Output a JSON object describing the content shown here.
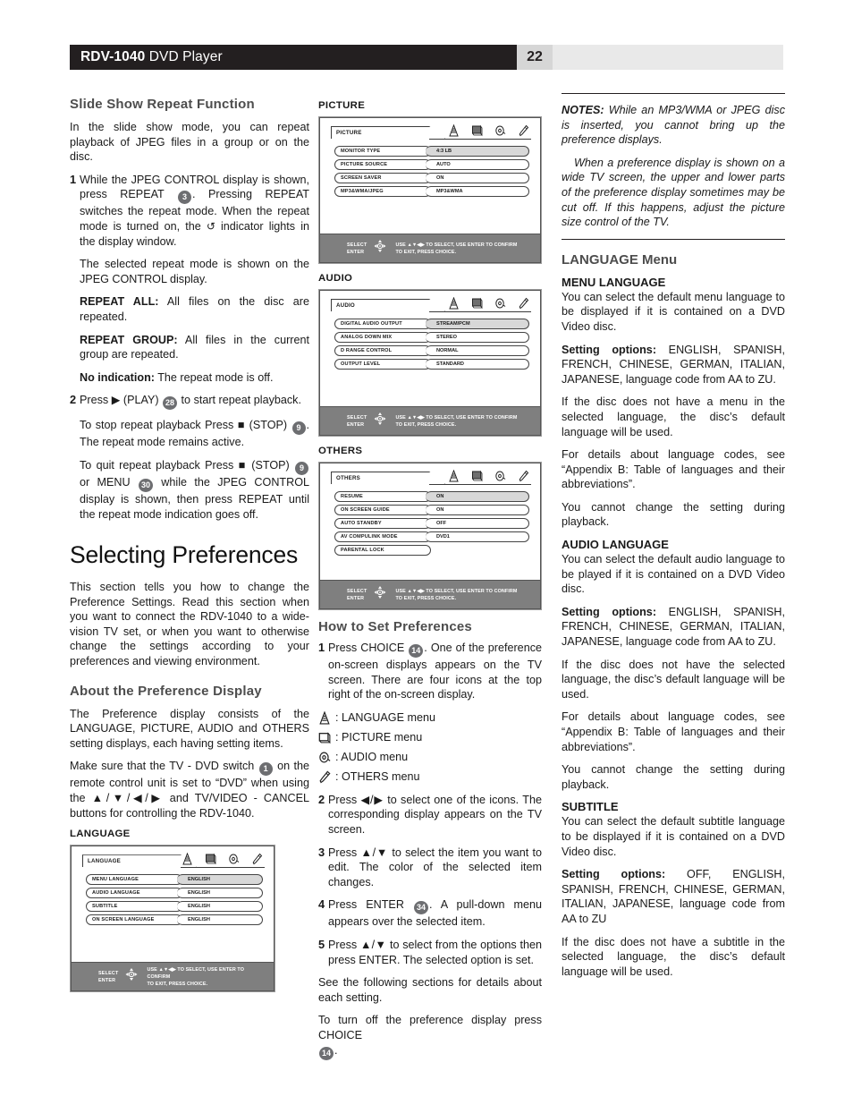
{
  "header": {
    "model": "RDV-1040",
    "product": " DVD Player",
    "page_number": "22"
  },
  "left_column": {
    "heading": "Slide Show Repeat Function",
    "intro": "In the slide show mode, you can repeat playback of JPEG files in a group or on the disc.",
    "step1_pre": "While the JPEG CONTROL display is shown, press REPEAT ",
    "step1_key": "3",
    "step1_mid": ". Pressing REPEAT switches the repeat mode. When the repeat mode is turned on, the ",
    "step1_post": " indicator lights in the display window.",
    "step1_note": "The selected repeat mode is shown on the JPEG CONTROL display.",
    "repeat_all_label": "REPEAT ALL:",
    "repeat_all_text": " All files on the disc are repeated.",
    "repeat_group_label": "REPEAT GROUP:",
    "repeat_group_text": " All files in the current group are repeated.",
    "no_indication_label": "No indication:",
    "no_indication_text": " The repeat mode is off.",
    "step2_pre": "Press ",
    "step2_play": "(PLAY)",
    "step2_key": "28",
    "step2_post": " to start repeat playback.",
    "stop_pre": "To stop repeat playback Press ",
    "stop_label": "(STOP)",
    "stop_key": "9",
    "stop_post": ". The repeat mode remains active.",
    "quit_pre": "To quit repeat playback Press ",
    "quit_stop": "(STOP)",
    "quit_key1": "9",
    "quit_mid": " or MENU ",
    "quit_key2": "30",
    "quit_post": " while the JPEG CONTROL display is shown, then press REPEAT until the repeat mode indication goes off.",
    "title": "Selecting Preferences",
    "intro2": "This section tells you how to change the Preference Settings. Read this section when you want to connect the RDV-1040 to a wide-vision TV set, or when you want to otherwise change the settings according to your preferences and viewing environment.",
    "about_heading": "About the Preference Display",
    "about_p1": "The Preference display consists of the LANGUAGE, PICTURE, AUDIO and OTHERS setting displays, each having setting items.",
    "about_p2_pre": "Make sure that the TV - DVD switch ",
    "about_p2_key": "1",
    "about_p2_post": " on the remote control unit is set to “DVD” when using the ▲/▼/◀/▶ and TV/VIDEO - CANCEL buttons for controlling the RDV-1040.",
    "lang_fig_label": "LANGUAGE"
  },
  "osd_footer": {
    "select": "SELECT",
    "enter": "ENTER",
    "hint_line1": "USE ▲▼◀▶ TO SELECT, USE ENTER TO CONFIRM",
    "hint_line2": "TO EXIT, PRESS CHOICE."
  },
  "osd_screens": {
    "language": {
      "tab": "LANGUAGE",
      "rows": [
        {
          "label": "MENU LANGUAGE",
          "value": "ENGLISH",
          "selected": true
        },
        {
          "label": "AUDIO LANGUAGE",
          "value": "ENGLISH",
          "selected": false
        },
        {
          "label": "SUBTITLE",
          "value": "ENGLISH",
          "selected": false
        },
        {
          "label": "ON SCREEN LANGUAGE",
          "value": "ENGLISH",
          "selected": false
        }
      ]
    },
    "picture": {
      "tab": "PICTURE",
      "rows": [
        {
          "label": "MONITOR TYPE",
          "value": "4:3 LB",
          "selected": true
        },
        {
          "label": "PICTURE SOURCE",
          "value": "AUTO",
          "selected": false
        },
        {
          "label": "SCREEN SAVER",
          "value": "ON",
          "selected": false
        },
        {
          "label": "MP3&WMA/JPEG",
          "value": "MP3&WMA",
          "selected": false
        }
      ]
    },
    "audio": {
      "tab": "AUDIO",
      "rows": [
        {
          "label": "DIGITAL AUDIO OUTPUT",
          "value": "STREAM/PCM",
          "selected": true
        },
        {
          "label": "ANALOG DOWN MIX",
          "value": "STEREO",
          "selected": false
        },
        {
          "label": "D RANGE CONTROL",
          "value": "NORMAL",
          "selected": false
        },
        {
          "label": "OUTPUT LEVEL",
          "value": "STANDARD",
          "selected": false
        }
      ]
    },
    "others": {
      "tab": "OTHERS",
      "rows": [
        {
          "label": "RESUME",
          "value": "ON",
          "selected": true
        },
        {
          "label": "ON SCREEN GUIDE",
          "value": "ON",
          "selected": false
        },
        {
          "label": "AUTO STANDBY",
          "value": "OFF",
          "selected": false
        },
        {
          "label": "AV COMPULINK MODE",
          "value": "DVD1",
          "selected": false
        },
        {
          "label": "PARENTAL LOCK",
          "value": "",
          "selected": false
        }
      ]
    }
  },
  "mid_column": {
    "picture_label": "PICTURE",
    "audio_label": "AUDIO",
    "others_label": "OTHERS",
    "how_heading": "How to Set Preferences",
    "step1_pre": "Press CHOICE ",
    "step1_key": "14",
    "step1_post": ". One of the preference on-screen displays appears on the TV screen. There are four icons at the top right of the on-screen display.",
    "icon_items": [
      {
        "icon": "language-flag-icon",
        "text": ": LANGUAGE menu"
      },
      {
        "icon": "picture-screen-icon",
        "text": ": PICTURE menu"
      },
      {
        "icon": "audio-disc-icon",
        "text": ": AUDIO menu"
      },
      {
        "icon": "others-wrench-icon",
        "text": ": OTHERS menu"
      }
    ],
    "step2": "Press ◀/▶ to select one of the icons. The corresponding display appears on the TV screen.",
    "step3": "Press ▲/▼ to select the item you want to edit. The color of the selected item changes.",
    "step4_pre": "Press ENTER ",
    "step4_key": "34",
    "step4_post": ". A pull-down menu appears over the selected item.",
    "step5": "Press ▲/▼ to select from the options then press ENTER. The selected option is set.",
    "see_following": "See the following sections for details about each setting.",
    "turn_off_pre": "To turn off the preference display press CHOICE ",
    "turn_off_key": "14",
    "turn_off_post": "."
  },
  "right_column": {
    "notes_label": "NOTES:",
    "notes_p1": " While an MP3/WMA or JPEG disc is inserted, you cannot bring up the preference displays.",
    "notes_p2": "When a preference display is shown on a wide TV screen, the upper and lower parts of the preference display sometimes may be cut off. If this happens, adjust the picture size control of the TV.",
    "language_menu_heading": "LANGUAGE Menu",
    "menu_language_heading": "MENU LANGUAGE",
    "menu_language_desc": "You can select the default menu language to be displayed if it is contained on a DVD Video disc.",
    "menu_language_opts_label": "Setting options:",
    "menu_language_opts": " ENGLISH, SPANISH, FRENCH, CHINESE, GERMAN, ITALIAN, JAPANESE, language code from AA to ZU.",
    "menu_language_note1": "If the disc does not have a menu in the selected language, the disc’s default language will be used.",
    "menu_language_note2": "For details about language codes, see “Appendix B: Table of languages and their abbreviations”.",
    "menu_language_note3": "You cannot change the setting during playback.",
    "audio_language_heading": "AUDIO LANGUAGE",
    "audio_language_desc": "You can select the default audio language to be played if it is contained on a DVD Video disc.",
    "audio_language_opts_label": "Setting options:",
    "audio_language_opts": " ENGLISH, SPANISH, FRENCH, CHINESE, GERMAN, ITALIAN, JAPANESE, language code from AA to ZU.",
    "audio_language_note1": "If the disc does not have the selected language, the disc’s default language will be used.",
    "audio_language_note2": "For details about language codes, see “Appendix B: Table of languages and their abbreviations”.",
    "audio_language_note3": "You cannot change the setting during playback.",
    "subtitle_heading": "SUBTITLE",
    "subtitle_desc": "You can select the default subtitle language to be displayed if it is contained on a DVD Video disc.",
    "subtitle_opts_label": "Setting options:",
    "subtitle_opts": " OFF, ENGLISH, SPANISH, FRENCH, CHINESE, GERMAN, ITALIAN, JAPANESE, language code from AA to ZU",
    "subtitle_note": "If the disc does not have a subtitle in the selected language, the disc’s default language will be used."
  }
}
